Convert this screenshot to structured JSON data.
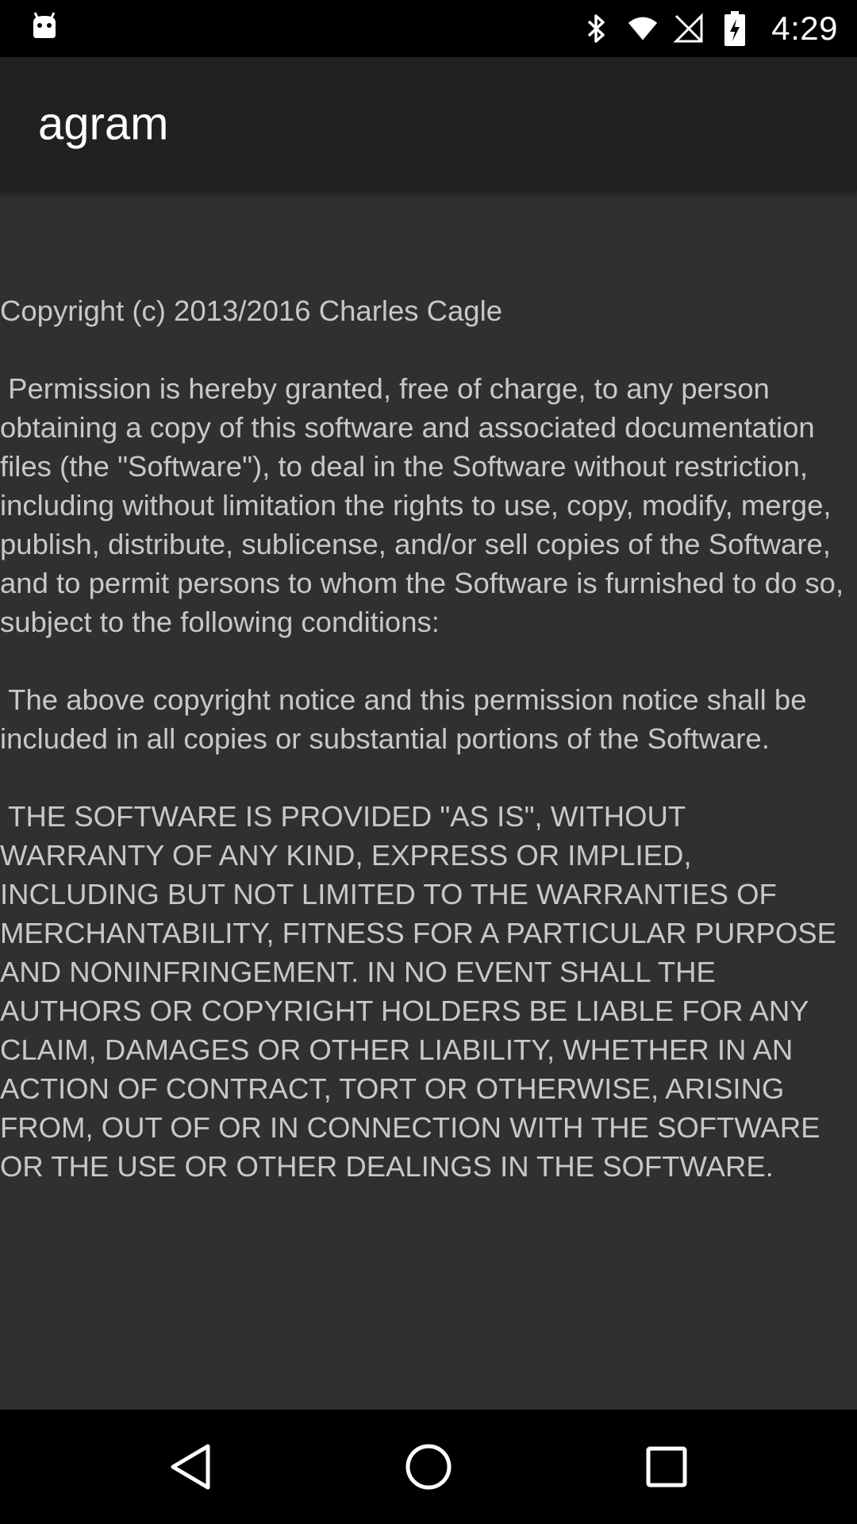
{
  "status_bar": {
    "time": "4:29",
    "icons": [
      "android-debug-icon",
      "bluetooth-icon",
      "wifi-icon",
      "no-sim-icon",
      "battery-charging-icon"
    ]
  },
  "app_bar": {
    "title": "agram"
  },
  "license": {
    "text": "Copyright (c) 2013/2016 Charles Cagle\n\n Permission is hereby granted, free of charge, to any person obtaining a copy of this software and associated documentation files (the \"Software\"), to deal in the Software without restriction, including without limitation the rights to use, copy, modify, merge, publish, distribute, sublicense, and/or sell copies of the Software, and to permit persons to whom the Software is furnished to do so, subject to the following conditions:\n\n The above copyright notice and this permission notice shall be included in all copies or substantial portions of the Software.\n\n THE SOFTWARE IS PROVIDED \"AS IS\", WITHOUT WARRANTY OF ANY KIND, EXPRESS OR IMPLIED, INCLUDING BUT NOT LIMITED TO THE WARRANTIES OF MERCHANTABILITY, FITNESS FOR A PARTICULAR PURPOSE AND NONINFRINGEMENT. IN NO EVENT SHALL THE AUTHORS OR COPYRIGHT HOLDERS BE LIABLE FOR ANY CLAIM, DAMAGES OR OTHER LIABILITY, WHETHER IN AN ACTION OF CONTRACT, TORT OR OTHERWISE, ARISING FROM, OUT OF OR IN CONNECTION WITH THE SOFTWARE OR THE USE OR OTHER DEALINGS IN THE SOFTWARE."
  },
  "nav_bar": {
    "buttons": [
      "back-icon",
      "home-icon",
      "recents-icon"
    ]
  },
  "colors": {
    "status_bar_bg": "#000000",
    "app_bar_bg": "#212121",
    "content_bg": "#303030",
    "text": "#c8c8c8",
    "title_text": "#ffffff"
  }
}
